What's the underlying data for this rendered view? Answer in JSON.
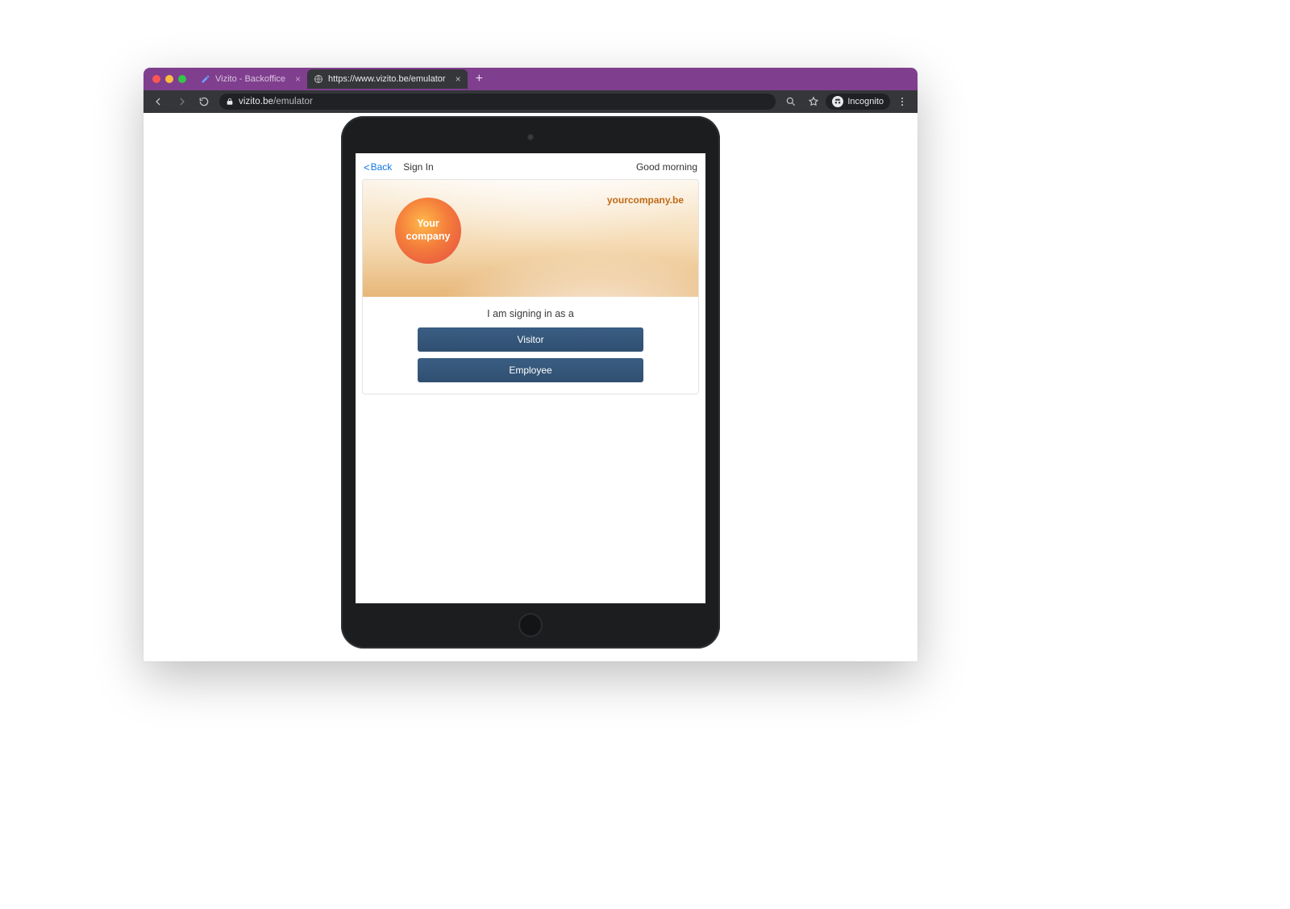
{
  "browser": {
    "tabs": [
      {
        "title": "Vizito - Backoffice",
        "active": false
      },
      {
        "title": "https://www.vizito.be/emulator",
        "active": true
      }
    ],
    "url_host": "vizito.be",
    "url_path": "/emulator",
    "incognito_label": "Incognito"
  },
  "app_bar": {
    "back_label": "Back",
    "sign_in_label": "Sign In",
    "greeting": "Good morning"
  },
  "banner": {
    "logo_line1": "Your",
    "logo_line2": "company",
    "link_text": "yourcompany.be"
  },
  "prompt_text": "I am signing in as a",
  "buttons": {
    "visitor": "Visitor",
    "employee": "Employee"
  }
}
